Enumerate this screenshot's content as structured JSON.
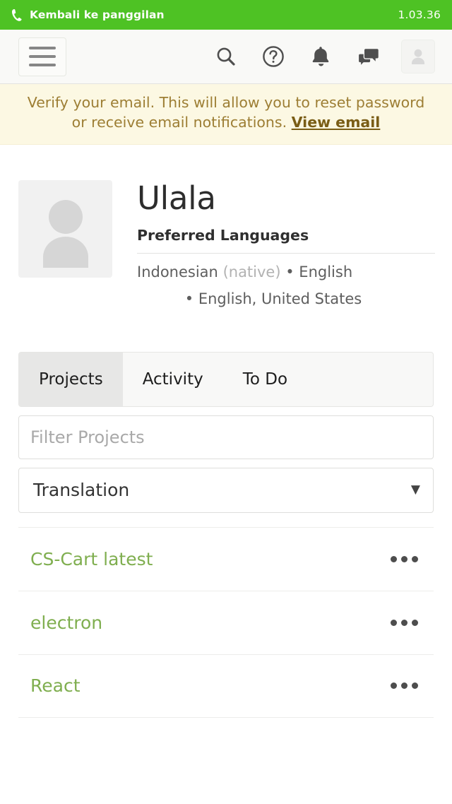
{
  "callbar": {
    "icon": "phone-icon",
    "label": "Kembali ke panggilan",
    "timer": "1.03.36",
    "color": "#4ec224"
  },
  "navbar": {
    "menu_button": "menu-icon",
    "icons": [
      {
        "name": "search-icon"
      },
      {
        "name": "help-circle-icon"
      },
      {
        "name": "bell-icon"
      },
      {
        "name": "chat-icon"
      }
    ],
    "avatar_button": "user-avatar-icon"
  },
  "banner": {
    "text": "Verify your email. This will allow you to reset password or receive email notifications.",
    "link": "View email",
    "background": "#fcf8e3",
    "text_color": "#9d7e34"
  },
  "profile": {
    "avatar": "user-placeholder-icon",
    "name": "Ulala",
    "section_title": "Preferred Languages",
    "languages_primary": "Indonesian",
    "languages_primary_note": "(native)",
    "languages_primary_rest": "• English",
    "languages_secondary": "• English, United States"
  },
  "tabs": [
    {
      "label": "Projects",
      "active": true
    },
    {
      "label": "Activity",
      "active": false
    },
    {
      "label": "To Do",
      "active": false
    }
  ],
  "filter": {
    "placeholder": "Filter Projects",
    "value": ""
  },
  "select": {
    "value": "Translation",
    "caret": "▼"
  },
  "projects": [
    {
      "name": "CS-Cart latest",
      "menu": "more-options-icon"
    },
    {
      "name": "electron",
      "menu": "more-options-icon"
    },
    {
      "name": "React",
      "menu": "more-options-icon"
    }
  ],
  "colors": {
    "accent_green": "#4ec224",
    "link_green": "#7fae4f"
  }
}
